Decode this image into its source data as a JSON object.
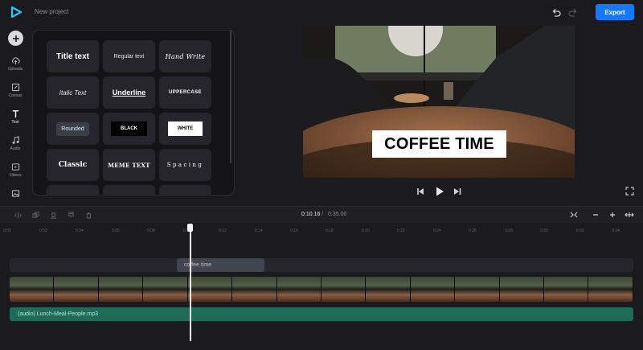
{
  "header": {
    "project_name": "New project",
    "export_label": "Export"
  },
  "sidebar": {
    "items": [
      {
        "label": "Uploads",
        "icon": "upload-icon"
      },
      {
        "label": "Canvas",
        "icon": "canvas-icon"
      },
      {
        "label": "Text",
        "icon": "text-icon"
      },
      {
        "label": "Audio",
        "icon": "music-icon"
      },
      {
        "label": "Videos",
        "icon": "video-icon"
      },
      {
        "label": "",
        "icon": "image-icon"
      }
    ]
  },
  "text_styles": [
    {
      "label": "Title text"
    },
    {
      "label": "Regular text"
    },
    {
      "label": "Hand Write"
    },
    {
      "label": "Italic Text"
    },
    {
      "label": "Underline"
    },
    {
      "label": "UPPERCASE"
    },
    {
      "label": "Rounded"
    },
    {
      "label": "BLACK"
    },
    {
      "label": "WHITE"
    },
    {
      "label": "Classic"
    },
    {
      "label": "MEME TEXT"
    },
    {
      "label": "Spacing"
    }
  ],
  "preview": {
    "caption": "COFFEE TIME"
  },
  "timeline": {
    "current_time": "0:10.16",
    "separator": "/",
    "total_time": "0:35.00",
    "ruler": [
      "0:00",
      "0:02",
      "0:04",
      "0:06",
      "0:08",
      "0:10",
      "0:12",
      "0:14",
      "0:16",
      "0:18",
      "0:20",
      "0:22",
      "0:24",
      "0:26",
      "0:28",
      "0:30",
      "0:32",
      "0:34"
    ],
    "text_clip_label": "coffee time",
    "audio_clip_label": "(audio) Lunch-Meal-People.mp3",
    "video_frame_count": 14
  },
  "colors": {
    "accent": "#1479ff",
    "background": "#1b1b1f",
    "audio_track": "#1f6b5a",
    "text_clip": "#414451"
  }
}
